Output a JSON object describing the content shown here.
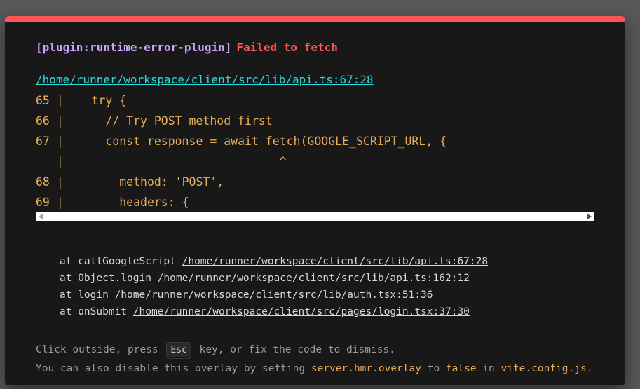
{
  "header": {
    "plugin": "[plugin:runtime-error-plugin]",
    "message": "Failed to fetch"
  },
  "file": "/home/runner/workspace/client/src/lib/api.ts:67:28",
  "frame": [
    "65 |    try {",
    "66 |      // Try POST method first",
    "67 |      const response = await fetch(GOOGLE_SCRIPT_URL, {",
    "   |                               ^",
    "68 |        method: 'POST',",
    "69 |        headers: {"
  ],
  "stack": [
    {
      "prefix": "at callGoogleScript ",
      "path": "/home/runner/workspace/client/src/lib/api.ts:67:28"
    },
    {
      "prefix": "at Object.login ",
      "path": "/home/runner/workspace/client/src/lib/api.ts:162:12"
    },
    {
      "prefix": "at login ",
      "path": "/home/runner/workspace/client/src/lib/auth.tsx:51:36"
    },
    {
      "prefix": "at onSubmit ",
      "path": "/home/runner/workspace/client/src/pages/login.tsx:37:30"
    }
  ],
  "tip": {
    "line1_before": "Click outside, press ",
    "key": "Esc",
    "line1_after": " key, or fix the code to dismiss.",
    "line2_before": "You can also disable this overlay by setting ",
    "setting": "server.hmr.overlay",
    "line2_to": " to ",
    "value": "false",
    "line2_in": " in ",
    "config": "vite.config.js",
    "line2_end": "."
  },
  "colors": {
    "background": "#595959",
    "panel": "#181818",
    "accent_red": "#ff5555",
    "plugin_purple": "#cfa4ff",
    "link_cyan": "#2dd9da",
    "code_yellow": "#e8ad59"
  }
}
